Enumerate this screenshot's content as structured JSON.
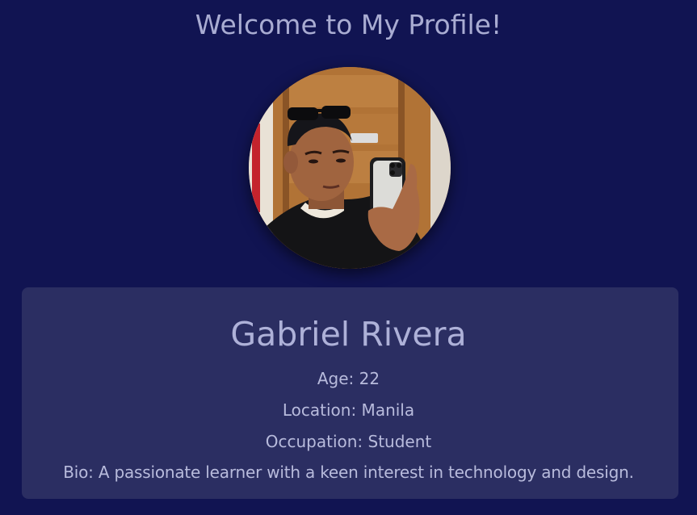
{
  "page": {
    "title": "Welcome to My Profile!"
  },
  "profile": {
    "name": "Gabriel Rivera",
    "age_line": "Age: 22",
    "location_line": "Location: Manila",
    "occupation_line": "Occupation: Student",
    "bio_line": "Bio: A passionate learner with a keen interest in technology and design."
  },
  "theme": {
    "background": "#111452",
    "card": "#2b2e62",
    "text": "#aeb1d8"
  },
  "avatar": {
    "icon": "profile-photo"
  }
}
